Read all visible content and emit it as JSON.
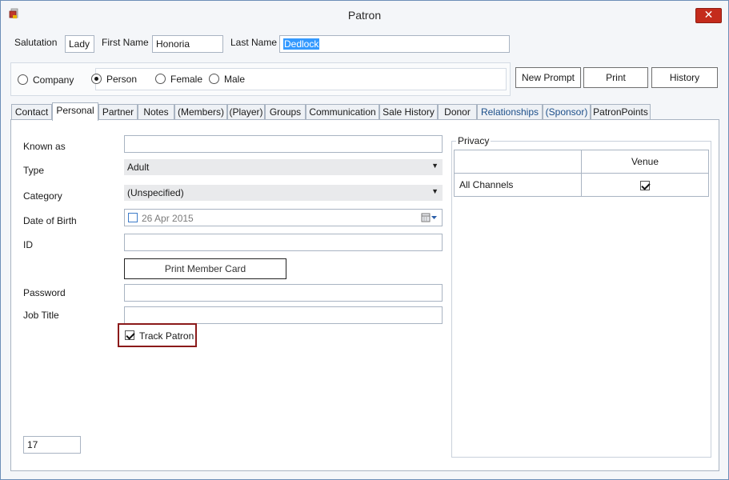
{
  "window": {
    "title": "Patron",
    "close_glyph": "✕"
  },
  "icons": {
    "app": "patron-app-icon",
    "close": "close-icon",
    "dropdown": "chevron-down-icon",
    "calendar": "calendar-icon",
    "check": "check-icon"
  },
  "colors": {
    "close_button": "#c42b1c",
    "highlight": "#8b1a1a",
    "selection": "#3399ff",
    "tab_blue": "#1c4f8a"
  },
  "header": {
    "salutation_label": "Salutation",
    "salutation_value": "Lady",
    "first_name_label": "First Name",
    "first_name_value": "Honoria",
    "last_name_label": "Last Name",
    "last_name_value": "Dedlock"
  },
  "patron_type": {
    "options": [
      "Company",
      "Person",
      "Female",
      "Male"
    ],
    "selected": "Person"
  },
  "actions": {
    "new_prompt": "New Prompt",
    "print": "Print",
    "history": "History"
  },
  "tabs": [
    {
      "label": "Contact"
    },
    {
      "label": "Personal"
    },
    {
      "label": "Partner"
    },
    {
      "label": "Notes"
    },
    {
      "label": "(Members)"
    },
    {
      "label": "(Player)"
    },
    {
      "label": "Groups"
    },
    {
      "label": "Communication"
    },
    {
      "label": "Sale History"
    },
    {
      "label": "Donor"
    },
    {
      "label": "Relationships"
    },
    {
      "label": "(Sponsor)"
    },
    {
      "label": "PatronPoints"
    }
  ],
  "active_tab": "Personal",
  "personal": {
    "known_as_label": "Known as",
    "known_as_value": "",
    "type_label": "Type",
    "type_value": "Adult",
    "category_label": "Category",
    "category_value": "(Unspecified)",
    "dob_label": "Date of Birth",
    "dob_value": "26 Apr 2015",
    "dob_checked": false,
    "id_label": "ID",
    "id_value": "",
    "print_member_card": "Print Member Card",
    "password_label": "Password",
    "password_value": "",
    "job_title_label": "Job Title",
    "job_title_value": "",
    "track_patron_label": "Track Patron",
    "track_patron_checked": true,
    "counter_value": "17"
  },
  "privacy": {
    "legend": "Privacy",
    "column_header": "Venue",
    "rows": [
      {
        "label": "All Channels",
        "venue_checked": true
      }
    ]
  }
}
